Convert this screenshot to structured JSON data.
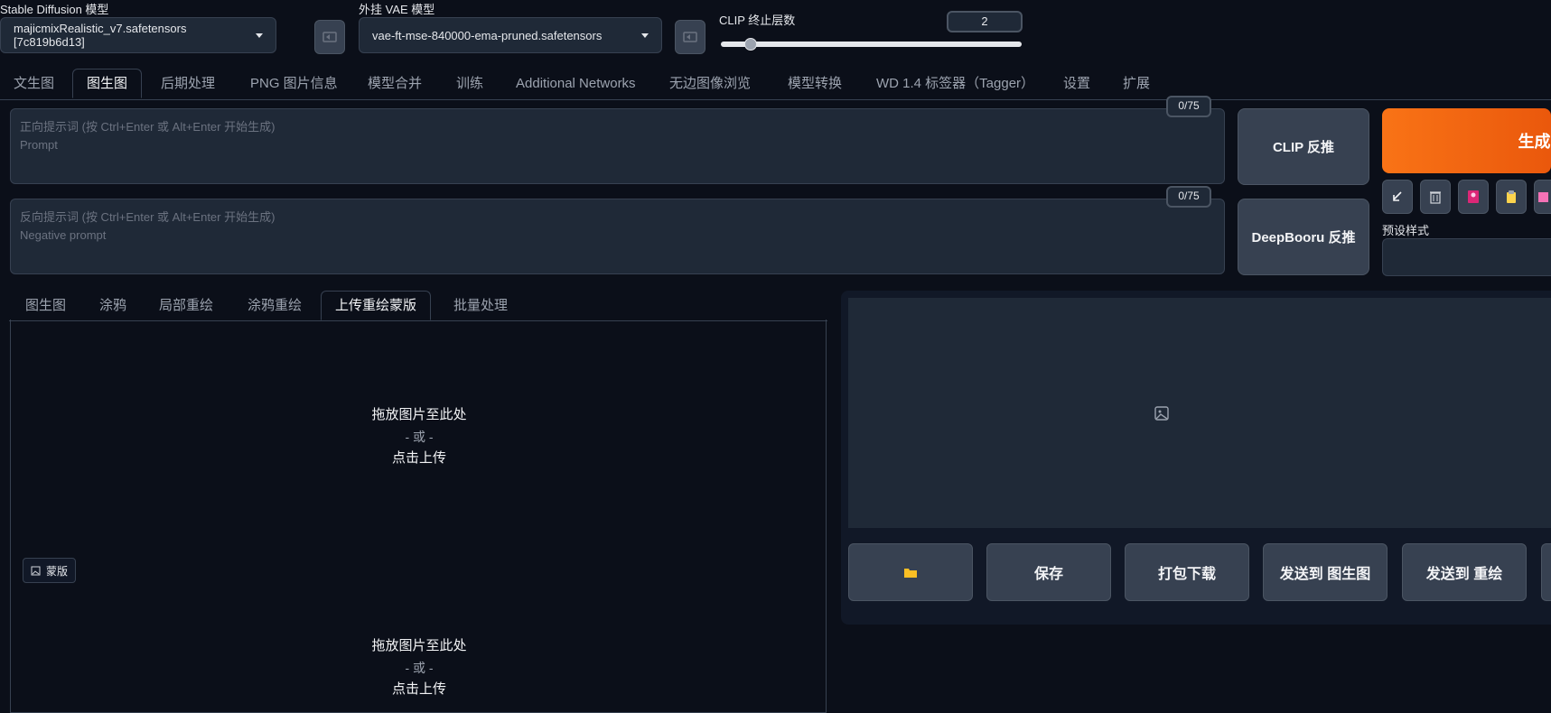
{
  "model": {
    "label": "Stable Diffusion 模型",
    "value": "majicmixRealistic_v7.safetensors [7c819b6d13]"
  },
  "vae": {
    "label": "外挂 VAE 模型",
    "value": "vae-ft-mse-840000-ema-pruned.safetensors"
  },
  "clip": {
    "label": "CLIP 终止层数",
    "value": "2",
    "slider_fraction": 0.1
  },
  "main_tabs": [
    "文生图",
    "图生图",
    "后期处理",
    "PNG 图片信息",
    "模型合并",
    "训练",
    "Additional Networks",
    "无边图像浏览",
    "模型转换",
    "WD 1.4 标签器（Tagger）",
    "设置",
    "扩展"
  ],
  "prompt": {
    "placeholder_line1": "正向提示词 (按 Ctrl+Enter 或 Alt+Enter 开始生成)",
    "placeholder_line2": "Prompt",
    "counter": "0/75"
  },
  "negative": {
    "placeholder_line1": "反向提示词 (按 Ctrl+Enter 或 Alt+Enter 开始生成)",
    "placeholder_line2": "Negative prompt",
    "counter": "0/75"
  },
  "buttons": {
    "clip_interrogate": "CLIP 反推",
    "deepbooru": "DeepBooru 反推",
    "generate": "生成"
  },
  "styles_label": "预设样式",
  "sub_tabs": [
    "图生图",
    "涂鸦",
    "局部重绘",
    "涂鸦重绘",
    "上传重绘蒙版",
    "批量处理"
  ],
  "upload": {
    "drop": "拖放图片至此处",
    "or": "- 或 -",
    "click": "点击上传",
    "mask_badge": "蒙版"
  },
  "output_buttons": [
    "保存",
    "打包下载",
    "发送到 图生图",
    "发送到 重绘"
  ],
  "colors": {
    "accent": "#f97316",
    "background": "#0b0f19",
    "panel": "#1f2937"
  }
}
